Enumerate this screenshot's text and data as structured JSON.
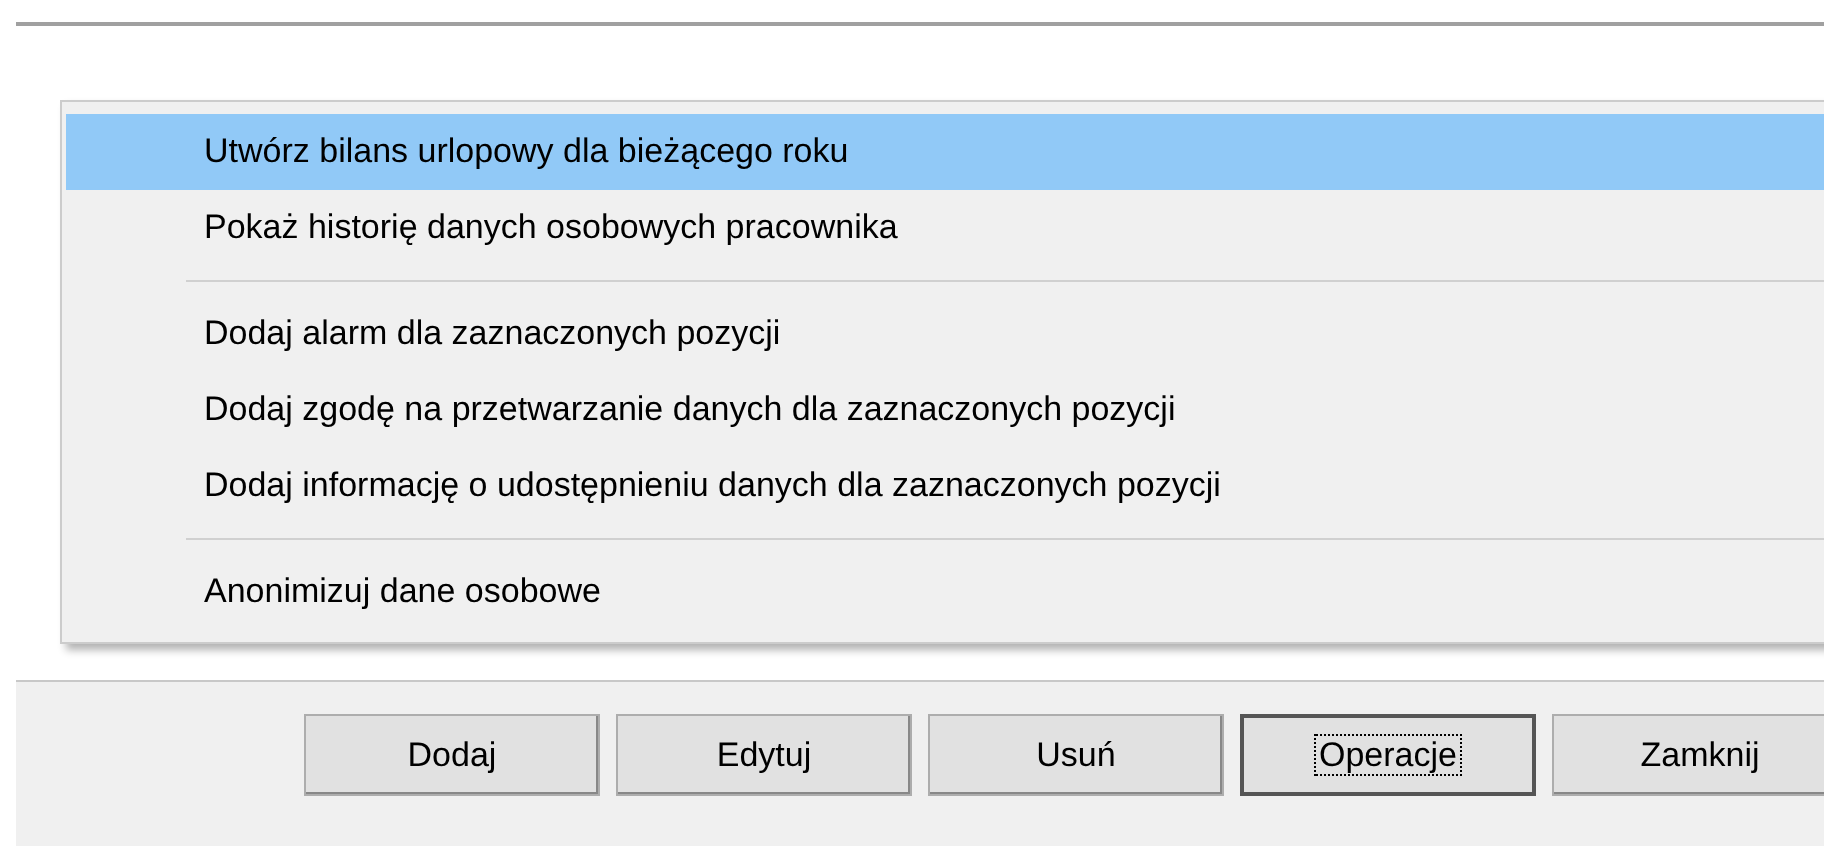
{
  "menu": {
    "items": [
      {
        "kind": "item",
        "label": "Utwórz bilans urlopowy dla bieżącego roku",
        "selected": true
      },
      {
        "kind": "item",
        "label": "Pokaż historię danych osobowych pracownika",
        "selected": false
      },
      {
        "kind": "separator"
      },
      {
        "kind": "item",
        "label": "Dodaj alarm dla zaznaczonych pozycji",
        "selected": false
      },
      {
        "kind": "item",
        "label": "Dodaj zgodę na przetwarzanie danych dla zaznaczonych pozycji",
        "selected": false
      },
      {
        "kind": "item",
        "label": "Dodaj informację o udostępnieniu danych dla zaznaczonych pozycji",
        "selected": false
      },
      {
        "kind": "separator"
      },
      {
        "kind": "item",
        "label": "Anonimizuj dane osobowe",
        "selected": false
      }
    ]
  },
  "buttons": [
    {
      "label": "Dodaj",
      "focused": false
    },
    {
      "label": "Edytuj",
      "focused": false
    },
    {
      "label": "Usuń",
      "focused": false
    },
    {
      "label": "Operacje",
      "focused": true
    },
    {
      "label": "Zamknij",
      "focused": false
    }
  ]
}
